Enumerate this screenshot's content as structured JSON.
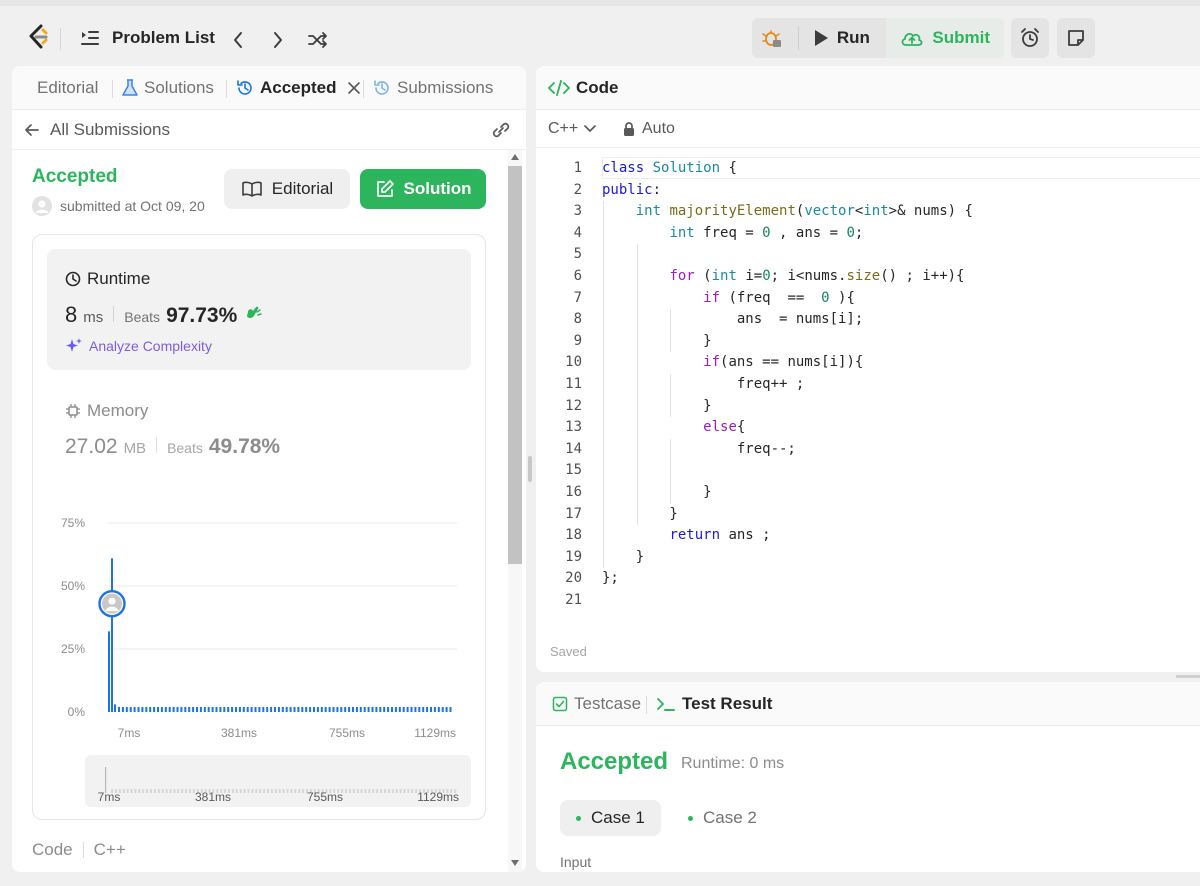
{
  "navbar": {
    "problem_list": "Problem List",
    "run_label": "Run",
    "submit_label": "Submit"
  },
  "left_panel": {
    "tabs": [
      {
        "label": "Editorial"
      },
      {
        "label": "Solutions"
      },
      {
        "label": "Accepted"
      },
      {
        "label": "Submissions"
      }
    ],
    "back_label": "All Submissions",
    "status": "Accepted",
    "submitted_text": "submitted at Oct 09, 20",
    "editorial_button": "Editorial",
    "solution_button": "Solution",
    "runtime": {
      "label": "Runtime",
      "value": "8",
      "unit": "ms",
      "beats_label": "Beats",
      "beats_value": "97.73%",
      "analyze": "Analyze Complexity"
    },
    "memory": {
      "label": "Memory",
      "value": "27.02",
      "unit": "MB",
      "beats_label": "Beats",
      "beats_value": "49.78%"
    },
    "footer": {
      "code_label": "Code",
      "lang": "C++"
    }
  },
  "chart_data": {
    "type": "bar",
    "yticks": [
      "75%",
      "50%",
      "25%",
      "0%"
    ],
    "xticks": [
      "7ms",
      "381ms",
      "755ms",
      "1129ms"
    ],
    "ylim": [
      0,
      75
    ],
    "user_value_ms": 8,
    "bars": [
      {
        "x": "7ms",
        "value": 32
      },
      {
        "x": "8ms",
        "value": 61
      },
      {
        "x": "9ms",
        "value": 3
      },
      {
        "x": "rest",
        "value": 2
      }
    ],
    "minimap_xticks": [
      "7ms",
      "381ms",
      "755ms",
      "1129ms"
    ]
  },
  "code_panel": {
    "title": "Code",
    "language": "C++",
    "mode": "Auto",
    "saved": "Saved",
    "lines": [
      "class Solution {",
      "public:",
      "    int majorityElement(vector<int>& nums) {",
      "        int freq = 0 , ans = 0;",
      "",
      "        for (int i=0; i<nums.size() ; i++){",
      "            if (freq  ==  0 ){",
      "                ans  = nums[i];",
      "            }",
      "            if(ans == nums[i]){",
      "                freq++ ;",
      "            }",
      "            else{",
      "                freq--;",
      "",
      "            }",
      "        }",
      "        return ans ;",
      "    }",
      "};",
      ""
    ]
  },
  "test_panel": {
    "testcase_tab": "Testcase",
    "result_tab": "Test Result",
    "status": "Accepted",
    "runtime": "Runtime: 0 ms",
    "cases": [
      "Case 1",
      "Case 2"
    ],
    "input_label": "Input"
  },
  "colors": {
    "accent_green": "#2db55d",
    "link_blue": "#1a73e8",
    "chart_blue": "#1a73e8"
  }
}
